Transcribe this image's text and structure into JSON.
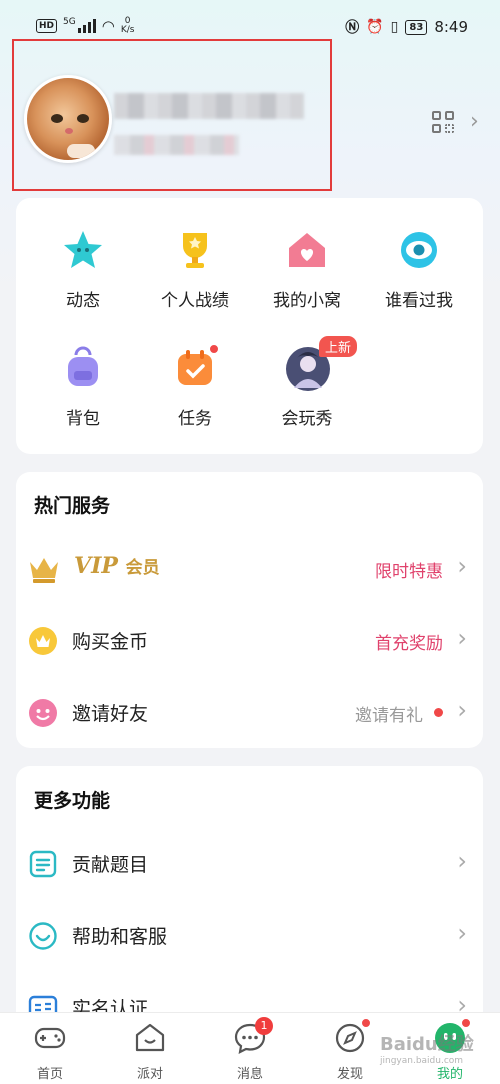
{
  "status_bar": {
    "network": "HD",
    "signal": "5G",
    "speed_value": "0",
    "speed_unit": "K/s",
    "battery": "83",
    "time": "8:49"
  },
  "profile": {
    "name": "",
    "id": ""
  },
  "quick_grid": [
    {
      "label": "动态"
    },
    {
      "label": "个人战绩"
    },
    {
      "label": "我的小窝"
    },
    {
      "label": "谁看过我"
    },
    {
      "label": "背包"
    },
    {
      "label": "任务"
    },
    {
      "label": "会玩秀",
      "badge": "上新"
    }
  ],
  "hot_services": {
    "title": "热门服务",
    "items": [
      {
        "label": "VIP",
        "sub": "会员",
        "right": "限时特惠"
      },
      {
        "label": "购买金币",
        "right": "首充奖励"
      },
      {
        "label": "邀请好友",
        "right": "邀请有礼"
      }
    ]
  },
  "more_features": {
    "title": "更多功能",
    "items": [
      {
        "label": "贡献题目"
      },
      {
        "label": "帮助和客服"
      },
      {
        "label": "实名认证"
      }
    ]
  },
  "bottom_nav": [
    {
      "label": "首页"
    },
    {
      "label": "派对"
    },
    {
      "label": "消息",
      "badge": "1"
    },
    {
      "label": "发现"
    },
    {
      "label": "我的",
      "active": true
    }
  ],
  "watermark": {
    "text": "Baidu经验",
    "sub": "jingyan.baidu.com"
  },
  "colors": {
    "accent_green": "#22b56a",
    "highlight_pink": "#e0426c",
    "annotation_red": "#e23b3b"
  }
}
